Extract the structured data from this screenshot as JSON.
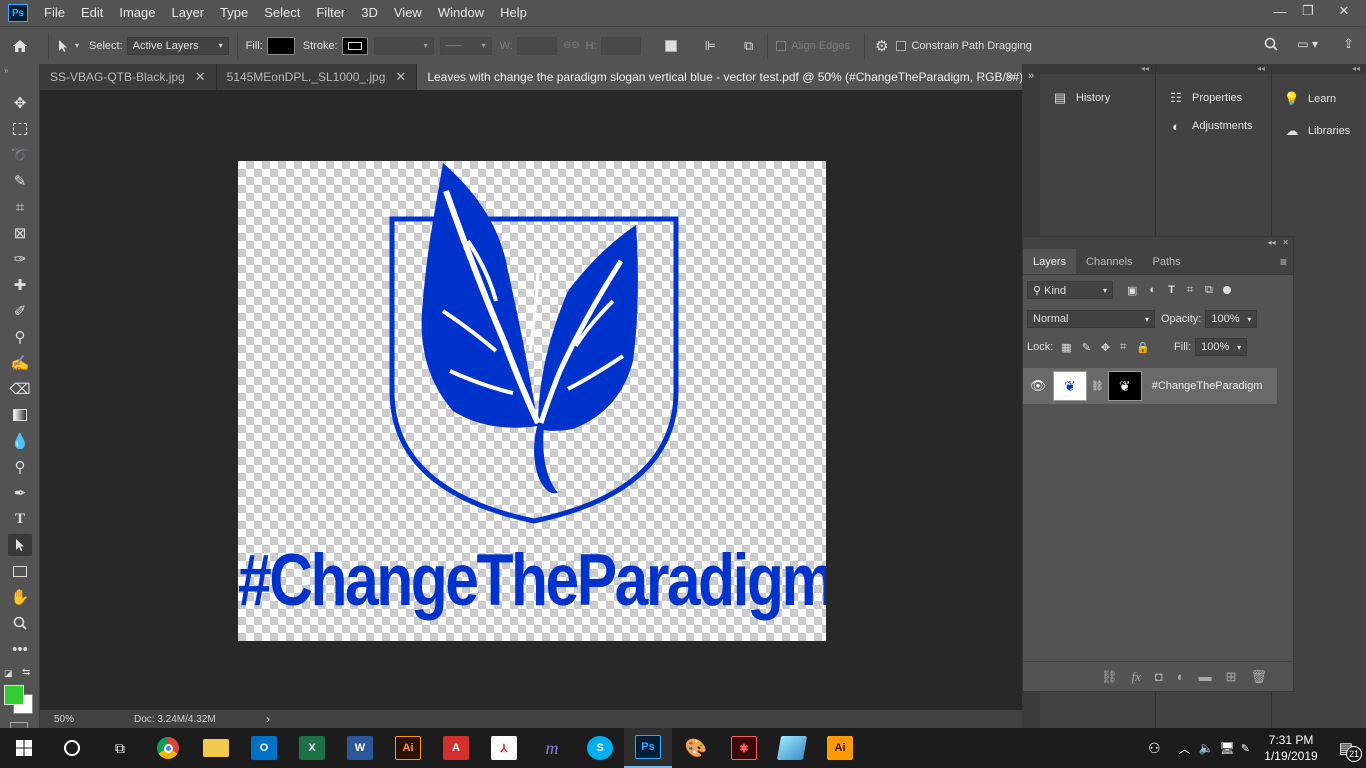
{
  "app": {
    "logo": "Ps"
  },
  "menu": [
    "File",
    "Edit",
    "Image",
    "Layer",
    "Type",
    "Select",
    "Filter",
    "3D",
    "View",
    "Window",
    "Help"
  ],
  "window_controls": {
    "minimize": "—",
    "restore": "❐",
    "close": "✕"
  },
  "options": {
    "select_label": "Select:",
    "select_value": "Active Layers",
    "fill_label": "Fill:",
    "stroke_label": "Stroke:",
    "w_label": "W:",
    "h_label": "H:",
    "align_edges": "Align Edges",
    "constrain_path": "Constrain Path Dragging"
  },
  "tabs": [
    {
      "label": "SS-VBAG-QTB-Black.jpg"
    },
    {
      "label": "5145MEonDPL._SL1000_.jpg"
    },
    {
      "label": "Leaves with change the paradigm slogan vertical blue - vector test.pdf @ 50% (#ChangeTheParadigm, RGB/8#) *"
    }
  ],
  "document": {
    "slogan": "#ChangeTheParadigm",
    "ink_color": "#0033cc"
  },
  "status": {
    "zoom": "50%",
    "doc": "Doc: 3.24M/4.32M",
    "arrow": "›"
  },
  "panels": {
    "history": "History",
    "properties": "Properties",
    "adjustments": "Adjustments",
    "learn": "Learn",
    "libraries": "Libraries"
  },
  "layers_panel": {
    "tabs": [
      "Layers",
      "Channels",
      "Paths"
    ],
    "filter_kind": "Kind",
    "blend_mode": "Normal",
    "opacity_label": "Opacity:",
    "opacity_value": "100%",
    "lock_label": "Lock:",
    "fill_label": "Fill:",
    "fill_value": "100%",
    "layer_name": "#ChangeTheParadigm"
  },
  "colors": {
    "foreground": "#33cc33",
    "background": "#ffffff",
    "accent": "#31a8ff"
  },
  "taskbar": {
    "apps": [
      "chrome-icon",
      "file-explorer-icon",
      "outlook-icon",
      "excel-icon",
      "word-icon",
      "illustrator-icon",
      "acrobat-icon",
      "acrobat-reader-icon",
      "m-app-icon",
      "skype-icon",
      "photoshop-icon",
      "paint-icon",
      "animate-icon",
      "gem-icon",
      "illustrator-icon-2"
    ],
    "ai_label": "Ai",
    "ps_label": "Ps",
    "time": "7:31 PM",
    "date": "1/19/2019",
    "notifications": "21"
  }
}
